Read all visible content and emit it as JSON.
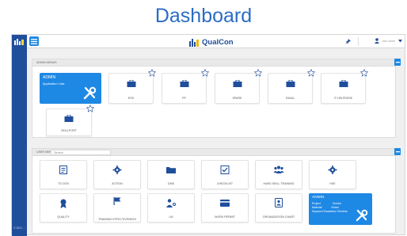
{
  "headline": "Dashboard",
  "brand": {
    "name": "QualCon"
  },
  "header": {
    "user_text": "user name"
  },
  "admin_panel": {
    "title": "Admin Menus",
    "admin_tile": {
      "title": "ADMIN",
      "subtitle": "Application Lists"
    },
    "tiles": [
      {
        "label": "ESS"
      },
      {
        "label": "PP"
      },
      {
        "label": "SPARE"
      },
      {
        "label": "EMAIL"
      },
      {
        "label": "IT HELPDESK"
      },
      {
        "label": "SKILLPORT"
      }
    ]
  },
  "user_panel": {
    "title": "User Menus",
    "search_placeholder": "Search",
    "tiles": [
      {
        "label": "TO DOS",
        "icon": "todo-icon"
      },
      {
        "label": "ACTION",
        "icon": "gear-icon"
      },
      {
        "label": "DMS",
        "icon": "folder-icon"
      },
      {
        "label": "CHECKLIST",
        "icon": "checklist-icon"
      },
      {
        "label": "HARD SKILL TRAINING",
        "icon": "group-icon"
      },
      {
        "label": "HSE",
        "icon": "gear-icon"
      },
      {
        "label": "QUALITY",
        "icon": "quality-icon"
      },
      {
        "label": "TRAINING EFFECTIVENESS",
        "icon": "flag-icon"
      },
      {
        "label": "LM",
        "icon": "user-key-icon"
      },
      {
        "label": "WORK PERMIT",
        "icon": "card-icon"
      },
      {
        "label": "ORGANIZATION CHART",
        "icon": "badge-icon"
      }
    ],
    "admin_tile": {
      "title": "ADMIN",
      "lines": [
        "Project",
        "Vendor",
        "Material",
        "Ruled",
        "Keyword Escalation Timeline"
      ]
    }
  },
  "leftbar_footer": "© 2021 ...",
  "colors": {
    "accent": "#1e88e5",
    "nav": "#1f4e9b",
    "heading": "#2b6cc4"
  }
}
